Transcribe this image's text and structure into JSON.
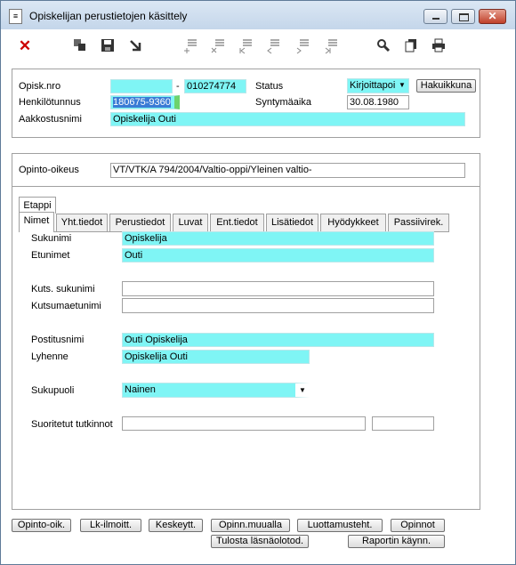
{
  "window": {
    "title": "Opiskelijan perustietojen käsittely"
  },
  "header": {
    "opisk_nro_label": "Opisk.nro",
    "opisk_nro_value": "",
    "dash": "-",
    "opisk_nro_suffix": "010274774",
    "status_label": "Status",
    "status_value": "Kirjoittapoi",
    "hakuikkuna_label": "Hakuikkuna",
    "henkilotunnus_label": "Henkilötunnus",
    "henkilotunnus_value": "180675-9360",
    "syntymaaika_label": "Syntymäaika",
    "syntymaaika_value": "30.08.1980",
    "aakkostusnimi_label": "Aakkostusnimi",
    "aakkostusnimi_value": "Opiskelija Outi"
  },
  "opinto": {
    "label": "Opinto-oikeus",
    "value": "VT/VTK/A 794/2004/Valtio-oppi/Yleinen valtio-"
  },
  "tabs": {
    "etappi": "Etappi",
    "items": [
      "Nimet",
      "Yht.tiedot",
      "Perustiedot",
      "Luvat",
      "Ent.tiedot",
      "Lisätiedot",
      "Hyödykkeet",
      "Passiivirek."
    ]
  },
  "nimet": {
    "sukunimi_label": "Sukunimi",
    "sukunimi_value": "Opiskelija",
    "etunimet_label": "Etunimet",
    "etunimet_value": "Outi",
    "kuts_sukunimi_label": "Kuts. sukunimi",
    "kuts_sukunimi_value": "",
    "kutsumaetunimi_label": "Kutsumaetunimi",
    "kutsumaetunimi_value": "",
    "postitusnimi_label": "Postitusnimi",
    "postitusnimi_value": "Outi Opiskelija",
    "lyhenne_label": "Lyhenne",
    "lyhenne_value": "Opiskelija Outi",
    "sukupuoli_label": "Sukupuoli",
    "sukupuoli_value": "Nainen",
    "suoritetut_label": "Suoritetut tutkinnot"
  },
  "bottom_buttons": {
    "opinto_oik": "Opinto-oik.",
    "lk_ilmoitt": "Lk-ilmoitt.",
    "keskeytt": "Keskeytt.",
    "opinn_muualla": "Opinn.muualla",
    "luottamusteht": "Luottamusteht.",
    "opinnot": "Opinnot",
    "tulosta": "Tulosta läsnäolotod.",
    "raportin": "Raportin käynn."
  },
  "icons": {
    "close_color": "#cc0000"
  }
}
